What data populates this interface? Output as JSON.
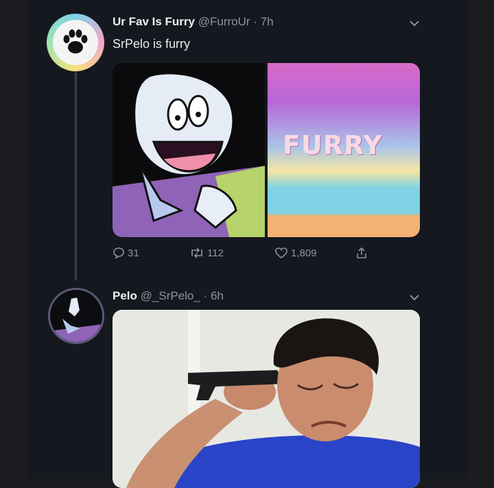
{
  "tweet1": {
    "display_name": "Ur Fav Is Furry",
    "handle_time": "@FurroUr · 7h",
    "text": "SrPelo is furry",
    "media_word": "FURRY",
    "actions": {
      "replies": "31",
      "retweets": "112",
      "likes": "1,809"
    }
  },
  "tweet2": {
    "display_name": "Pelo",
    "handle_time": "@_SrPelo_ · 6h"
  },
  "icons": {
    "reply": "comment-bubble-icon",
    "retweet": "retweet-icon",
    "like": "heart-icon",
    "share": "share-icon",
    "menu": "chevron-down-icon",
    "avatar1": "paw-print-icon"
  },
  "colors": {
    "background": "#15181f",
    "secondary_text": "#8b96a3"
  }
}
